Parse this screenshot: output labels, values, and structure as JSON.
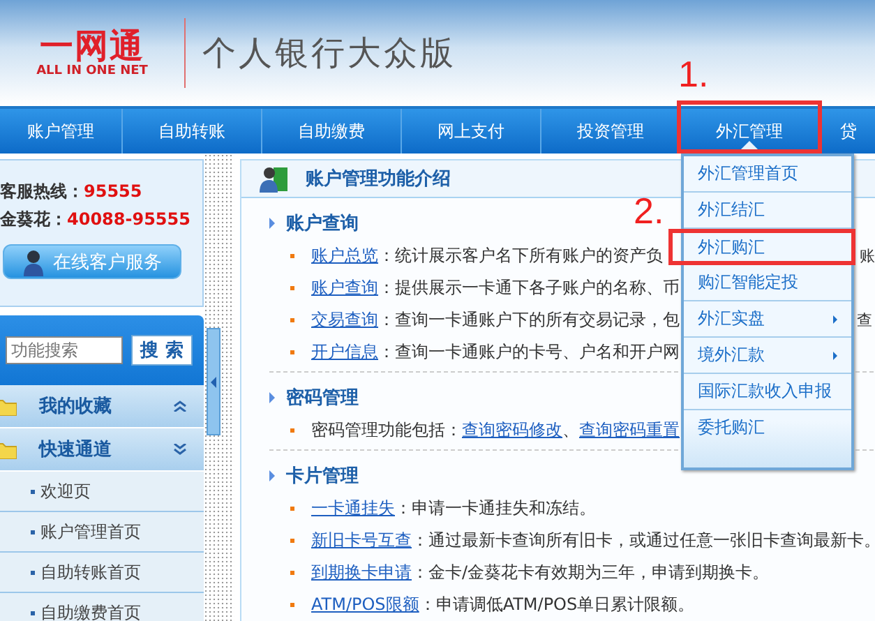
{
  "header": {
    "logo_text": "一网通",
    "logo_subtext": "ALL IN ONE NET",
    "title": "个人银行大众版"
  },
  "nav": [
    {
      "label": "账户管理",
      "selected": false
    },
    {
      "label": "自助转账",
      "selected": false
    },
    {
      "label": "自助缴费",
      "selected": false
    },
    {
      "label": "网上支付",
      "selected": false
    },
    {
      "label": "投资管理",
      "selected": false
    },
    {
      "label": "外汇管理",
      "selected": true
    },
    {
      "label": "贷",
      "selected": false
    }
  ],
  "hotlines": [
    {
      "label": "客服热线：",
      "number": "95555"
    },
    {
      "label": "金葵花：",
      "number": "40088-95555"
    }
  ],
  "service_button": "在线客户服务",
  "search": {
    "placeholder": "功能搜索",
    "button": "搜 索"
  },
  "sidebar": [
    {
      "label": "我的收藏",
      "expanded": false
    },
    {
      "label": "快速通道",
      "expanded": true,
      "children": [
        {
          "label": "欢迎页"
        },
        {
          "label": "账户管理首页"
        },
        {
          "label": "自助转账首页"
        },
        {
          "label": "自助缴费首页"
        }
      ]
    }
  ],
  "content": {
    "title": "账户管理功能介绍",
    "sections": [
      {
        "heading": "账户查询",
        "items": [
          {
            "link": "账户总览",
            "text": "：统计展示客户名下所有账户的资产负",
            "tail": "账"
          },
          {
            "link": "账户查询",
            "text": "：提供展示一卡通下各子账户的名称、币"
          },
          {
            "link": "交易查询",
            "text": "：查询一卡通账户下的所有交易记录，包",
            "tail": "查"
          },
          {
            "link": "开户信息",
            "text": "：查询一卡通账户的卡号、户名和开户网"
          }
        ]
      },
      {
        "heading": "密码管理",
        "items": [
          {
            "text": "密码管理功能包括：",
            "links": [
              "查询密码修改",
              "查询密码重置"
            ],
            "separator": "、"
          }
        ]
      },
      {
        "heading": "卡片管理",
        "items": [
          {
            "link": "一卡通挂失",
            "text": "：申请一卡通挂失和冻结。"
          },
          {
            "link": "新旧卡号互查",
            "text": "：通过最新卡查询所有旧卡，或通过任意一张旧卡查询最新卡。"
          },
          {
            "link": "到期换卡申请",
            "text": "：金卡/金葵花卡有效期为三年，申请到期换卡。"
          },
          {
            "link": "ATM/POS限额",
            "text": "：申请调低ATM/POS单日累计限额。"
          }
        ]
      }
    ]
  },
  "dropdown": [
    {
      "label": "外汇管理首页",
      "has_submenu": false,
      "selected": false
    },
    {
      "label": "外汇结汇",
      "has_submenu": false,
      "selected": false
    },
    {
      "label": "外汇购汇",
      "has_submenu": false,
      "selected": true
    },
    {
      "label": "购汇智能定投",
      "has_submenu": false,
      "selected": false
    },
    {
      "label": "外汇实盘",
      "has_submenu": true,
      "selected": false
    },
    {
      "label": "境外汇款",
      "has_submenu": true,
      "selected": false
    },
    {
      "label": "国际汇款收入申报",
      "has_submenu": false,
      "selected": false
    },
    {
      "label": "委托购汇",
      "has_submenu": false,
      "selected": false
    }
  ],
  "annotations": [
    {
      "label": "1."
    },
    {
      "label": "2."
    }
  ]
}
